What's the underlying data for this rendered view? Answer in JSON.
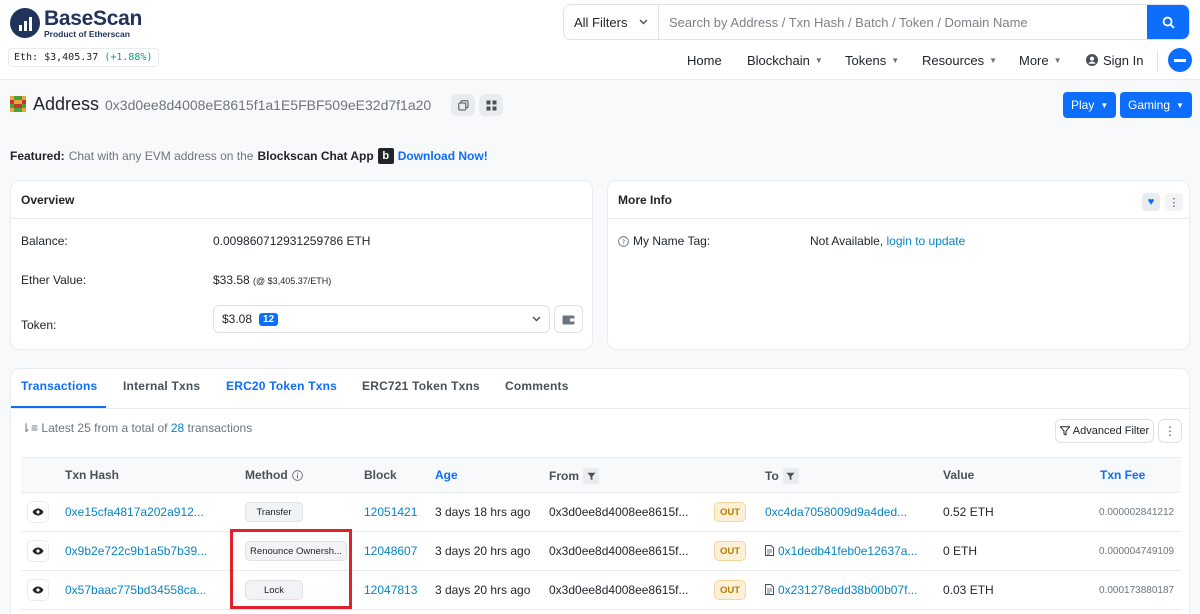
{
  "brand": {
    "name": "BaseScan",
    "subtitle": "Product of Etherscan",
    "eth_price_label": "Eth: $3,405.37",
    "eth_change": "(+1.88%)"
  },
  "search": {
    "filter": "All Filters",
    "placeholder": "Search by Address / Txn Hash / Batch / Token / Domain Name"
  },
  "nav": {
    "home": "Home",
    "blockchain": "Blockchain",
    "tokens": "Tokens",
    "resources": "Resources",
    "more": "More",
    "signin": "Sign In"
  },
  "address": {
    "title": "Address",
    "hash": "0x3d0ee8d4008eE8615f1a1E5FBF509eE32d7f1a20",
    "play": "Play",
    "gaming": "Gaming"
  },
  "featured": {
    "label": "Featured:",
    "text": "Chat with any EVM address on the",
    "app": "Blockscan Chat App",
    "badge": "b",
    "cta": "Download Now!"
  },
  "overview": {
    "title": "Overview",
    "balance_label": "Balance:",
    "balance_value": "0.009860712931259786 ETH",
    "ether_value_label": "Ether Value:",
    "ether_value": "$33.58",
    "ether_rate": "(@ $3,405.37/ETH)",
    "token_label": "Token:",
    "token_value": "$3.08",
    "token_count": "12"
  },
  "more_info": {
    "title": "More Info",
    "name_tag_label": "My Name Tag:",
    "name_tag_value": "Not Available,",
    "name_tag_link": "login to update"
  },
  "tabs": [
    "Transactions",
    "Internal Txns",
    "ERC20 Token Txns",
    "ERC721 Token Txns",
    "Comments"
  ],
  "tx_summary": {
    "prefix": "Latest 25 from a total of",
    "count": "28",
    "suffix": "transactions"
  },
  "advanced_filter": "Advanced Filter",
  "table": {
    "headers": {
      "hash": "Txn Hash",
      "method": "Method",
      "block": "Block",
      "age": "Age",
      "from": "From",
      "to": "To",
      "value": "Value",
      "fee": "Txn Fee"
    },
    "rows": [
      {
        "hash": "0xe15cfa4817a202a912...",
        "method": "Transfer",
        "block": "12051421",
        "age": "3 days 18 hrs ago",
        "from": "0x3d0ee8d4008ee8615f...",
        "direction": "OUT",
        "to": "0xc4da7058009d9a4ded...",
        "to_contract": false,
        "value": "0.52 ETH",
        "fee": "0.000002841212"
      },
      {
        "hash": "0x9b2e722c9b1a5b7b39...",
        "method": "Renounce Ownersh...",
        "block": "12048607",
        "age": "3 days 20 hrs ago",
        "from": "0x3d0ee8d4008ee8615f...",
        "direction": "OUT",
        "to": "0x1dedb41feb0e12637a...",
        "to_contract": true,
        "value": "0 ETH",
        "fee": "0.000004749109"
      },
      {
        "hash": "0x57baac775bd34558ca...",
        "method": "Lock",
        "block": "12047813",
        "age": "3 days 20 hrs ago",
        "from": "0x3d0ee8d4008ee8615f...",
        "direction": "OUT",
        "to": "0x231278edd38b00b07f...",
        "to_contract": true,
        "value": "0.03 ETH",
        "fee": "0.000173880187"
      }
    ]
  },
  "colors": {
    "primary": "#0d6efd",
    "link": "#0784c3",
    "brand_navy": "#21325b",
    "out_badge": "#fcf1d7",
    "highlight": "#e0202a"
  }
}
